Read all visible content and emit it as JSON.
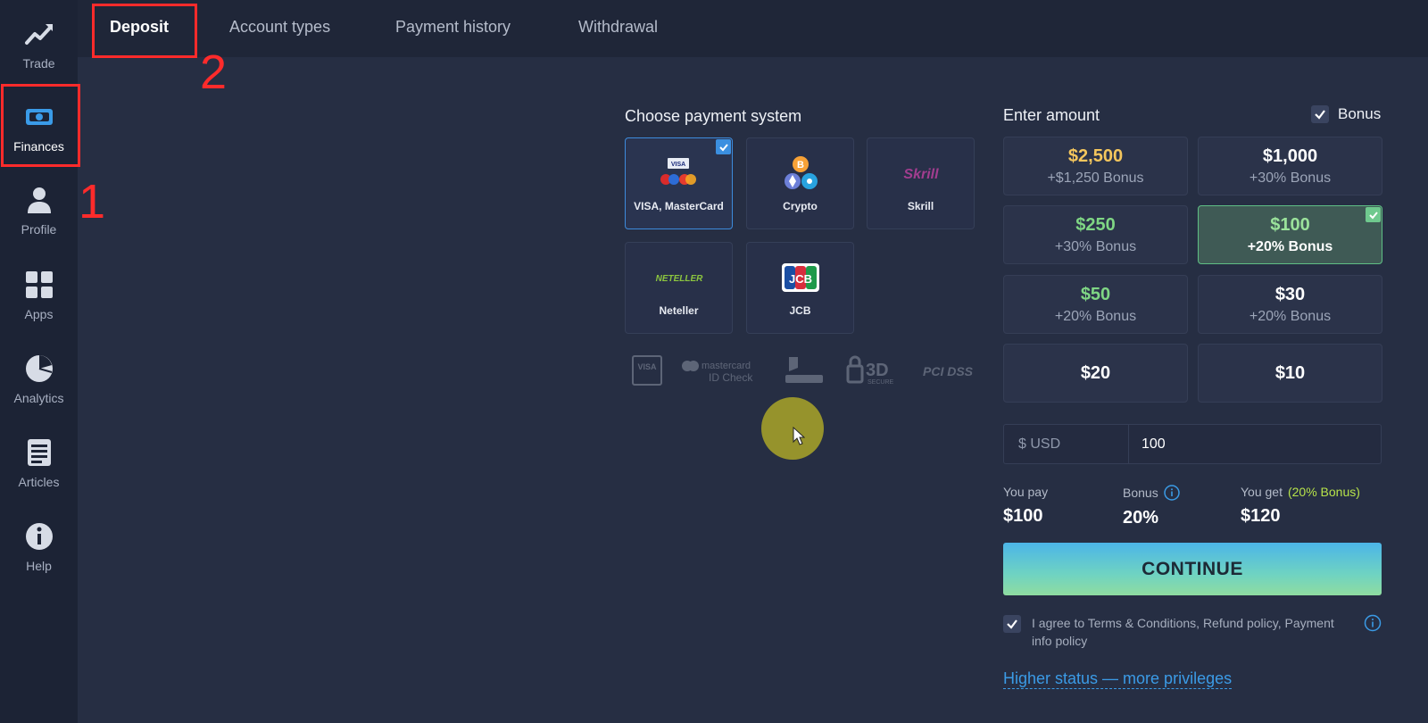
{
  "sidebar": {
    "items": [
      {
        "label": "Trade",
        "icon": "trend-up-icon"
      },
      {
        "label": "Finances",
        "icon": "banknote-icon"
      },
      {
        "label": "Profile",
        "icon": "person-icon"
      },
      {
        "label": "Apps",
        "icon": "grid-icon"
      },
      {
        "label": "Analytics",
        "icon": "pie-chart-icon"
      },
      {
        "label": "Articles",
        "icon": "article-icon"
      },
      {
        "label": "Help",
        "icon": "info-icon"
      }
    ]
  },
  "tabs": [
    {
      "label": "Deposit"
    },
    {
      "label": "Account types"
    },
    {
      "label": "Payment history"
    },
    {
      "label": "Withdrawal"
    }
  ],
  "annotations": {
    "step1": "1",
    "step2": "2"
  },
  "payment": {
    "title": "Choose payment system",
    "methods": [
      {
        "label": "VISA, MasterCard"
      },
      {
        "label": "Crypto"
      },
      {
        "label": "Skrill"
      },
      {
        "label": "Neteller"
      },
      {
        "label": "JCB"
      }
    ],
    "logo_text": {
      "visa": "VISA",
      "skrill": "Skrill",
      "neteller": "NETELLER",
      "jcb": "JCB"
    }
  },
  "security": {
    "visa": "VISA",
    "mastercard": "mastercard",
    "mastercard_sub": "ID Check",
    "threed": "3D",
    "threed_sub": "SECURE",
    "pci": "PCI DSS"
  },
  "amount": {
    "title": "Enter amount",
    "bonus_label": "Bonus",
    "options": [
      {
        "value": "$2,500",
        "bonus": "+$1,250 Bonus"
      },
      {
        "value": "$1,000",
        "bonus": "+30% Bonus"
      },
      {
        "value": "$250",
        "bonus": "+30% Bonus"
      },
      {
        "value": "$100",
        "bonus": "+20% Bonus"
      },
      {
        "value": "$50",
        "bonus": "+20% Bonus"
      },
      {
        "value": "$30",
        "bonus": "+20% Bonus"
      },
      {
        "value": "$20"
      },
      {
        "value": "$10"
      }
    ],
    "currency": "$ USD",
    "input_value": "100"
  },
  "summary": {
    "you_pay_label": "You pay",
    "you_pay_value": "$100",
    "bonus_label": "Bonus",
    "bonus_value": "20%",
    "you_get_label": "You get",
    "you_get_bonus": "(20% Bonus)",
    "you_get_value": "$120"
  },
  "continue_label": "CONTINUE",
  "agree_text": "I agree to Terms & Conditions, Refund policy, Payment info policy",
  "higher_status_link": "Higher status — more privileges",
  "colors": {
    "background": "#262e43",
    "sidebar": "#1c2335",
    "accent_blue": "#3b8fe0",
    "gold": "#f4c65d",
    "green": "#7fd684",
    "annotation_red": "#ff2b2b"
  }
}
